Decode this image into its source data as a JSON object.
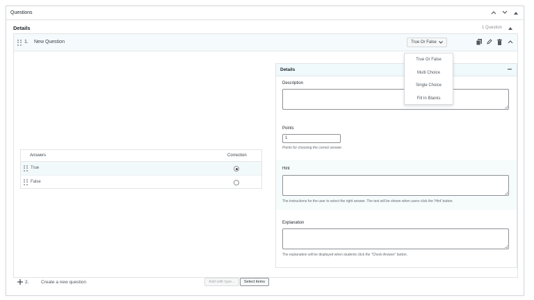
{
  "header": {
    "title": "Questions"
  },
  "details": {
    "label": "Details",
    "count": "1 Question"
  },
  "question": {
    "number": "1.",
    "title": "New Question",
    "type_label": "True Or False",
    "type_options": [
      "True Or False",
      "Multi Choice",
      "Single Choice",
      "Fill In Blanks"
    ]
  },
  "answers": {
    "col_answers": "Answers",
    "col_correction": "Correction",
    "rows": [
      {
        "label": "True",
        "correct": true
      },
      {
        "label": "False",
        "correct": false
      }
    ]
  },
  "side": {
    "title": "Details",
    "description_label": "Description",
    "points_label": "Points",
    "points_value": "1",
    "points_help": "Points for choosing the correct answer.",
    "hint_label": "Hint",
    "hint_help": "The instructions for the user to select the right answer. The text will be shown when users click the 'Hint' button.",
    "explanation_label": "Explanation",
    "explanation_help": "The explanation will be displayed when students click the \"Check Answer\" button."
  },
  "footer": {
    "number": "2.",
    "create_label": "Create a new question",
    "add_type_label": "Add with type...",
    "select_items_label": "Select items"
  },
  "colors": {
    "accent_bg": "#f2f9fb",
    "border": "#e0e3e6"
  }
}
